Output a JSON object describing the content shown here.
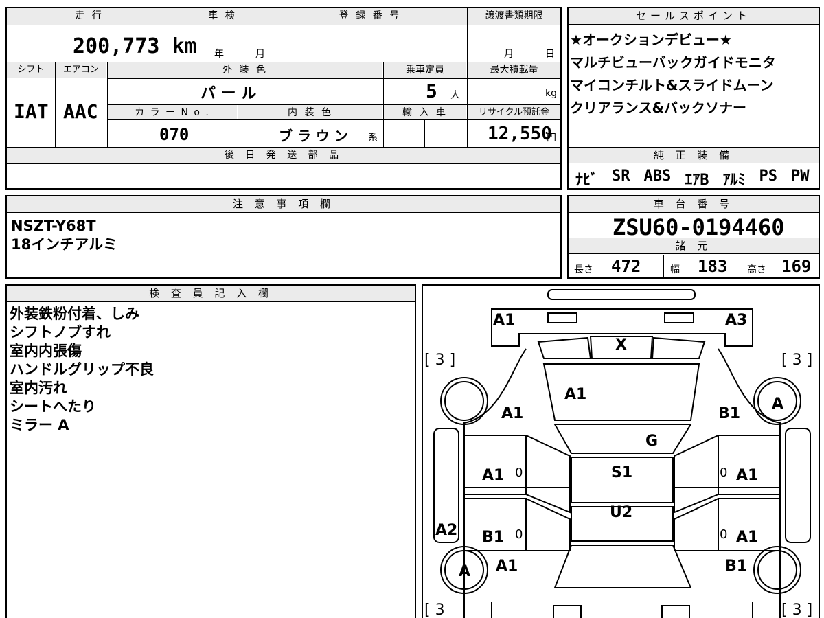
{
  "main": {
    "mileage_label": "走 行",
    "mileage": "200,773 km",
    "shaken_label": "車 検",
    "shaken_year": "年",
    "shaken_month": "月",
    "reg_label": "登 録 番 号",
    "transfer_label": "譲渡書類期限",
    "transfer_month": "月",
    "transfer_day": "日",
    "shift_label": "シフト",
    "shift": "IAT",
    "ac_label": "エアコン",
    "ac": "AAC",
    "ext_color_label": "外 装 色",
    "ext_color": "パ ー ル",
    "capacity_label": "乗車定員",
    "capacity": "5",
    "capacity_unit": "人",
    "max_load_label": "最大積載量",
    "max_load_unit": "kg",
    "color_no_label": "カ ラ ー N o .",
    "color_no": "070",
    "int_color_label": "内 装 色",
    "int_color": "ブ ラ ウ ン",
    "int_color_suffix": "系",
    "import_label": "輸 入 車",
    "recycle_label": "リサイクル預託金",
    "recycle": "12,550",
    "recycle_unit": "円",
    "later_parts_label": "後 日 発 送 部 品"
  },
  "sales": {
    "label": "セールスポイント",
    "lines": [
      "★オークションデビュー★",
      "マルチビューバックガイドモニタ",
      "マイコンチルト&スライドムーン",
      "クリアランス&バックソナー"
    ]
  },
  "equipment": {
    "label": "純 正 装 備",
    "items": [
      "ﾅﾋﾞ",
      "SR",
      "ABS",
      "ｴｱB",
      "ｱﾙﾐ",
      "PS",
      "PW"
    ]
  },
  "notes": {
    "label": "注 意 事 項 欄",
    "lines": [
      "NSZT-Y68T",
      "18インチアルミ"
    ]
  },
  "chassis": {
    "label": "車 台 番 号",
    "number": "ZSU60-0194460",
    "spec_label": "諸 元",
    "length_label": "長さ",
    "length": "472",
    "width_label": "幅",
    "width": "183",
    "height_label": "高さ",
    "height": "169"
  },
  "inspector": {
    "label": "検 査 員 記 入 欄",
    "lines": [
      "外装鉄粉付着、しみ",
      "シフトノブすれ",
      "室内内張傷",
      "ハンドルグリップ不良",
      "室内汚れ",
      "シートへたり",
      "ミラー A"
    ]
  },
  "diagram": {
    "front_left": "A1",
    "front_right": "A3",
    "windshield": "X",
    "hood": "A1",
    "left_fender": "A1",
    "right_fender": "B1",
    "right_front_wheel": "A",
    "roof_front": "G",
    "roof": "S1",
    "trunk": "U2",
    "left_front_door": "A1",
    "left_front_door_zero": "0",
    "right_front_door": "A1",
    "right_front_door_zero": "0",
    "left_rear_door": "B1",
    "left_rear_door_zero": "0",
    "right_rear_door": "A1",
    "right_rear_door_zero": "0",
    "left_rocker": "A2",
    "left_rear_wheel": "A",
    "left_quarter": "A1",
    "right_quarter": "B1",
    "tread_fl": "[ 3 ]",
    "tread_fr": "[ 3 ]",
    "tread_rl": "[ 3",
    "tread_rr": "[ 3 ]"
  }
}
